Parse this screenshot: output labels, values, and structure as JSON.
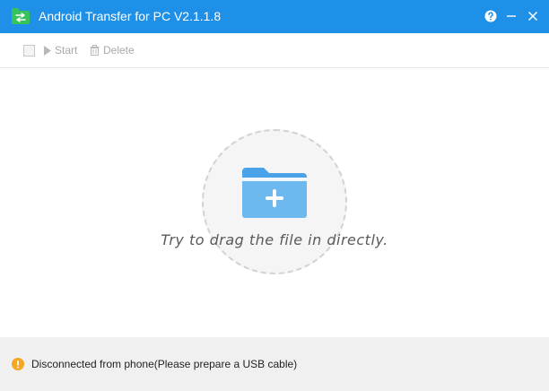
{
  "window": {
    "title": "Android Transfer for PC V2.1.1.8",
    "accent_color": "#1e90e8",
    "icons": [
      "transfer-app-icon",
      "help-icon",
      "minimize-icon",
      "close-icon"
    ]
  },
  "toolbar": {
    "select_all_checked": false,
    "start_label": "Start",
    "delete_label": "Delete",
    "icons": [
      "play-icon",
      "trash-icon"
    ]
  },
  "dropzone": {
    "hint": "Try to drag the file in directly.",
    "icon": "add-folder-icon"
  },
  "status": {
    "text": "Disconnected from phone(Please prepare a USB cable)",
    "icon": "warning-icon",
    "color": "#f5a623"
  }
}
